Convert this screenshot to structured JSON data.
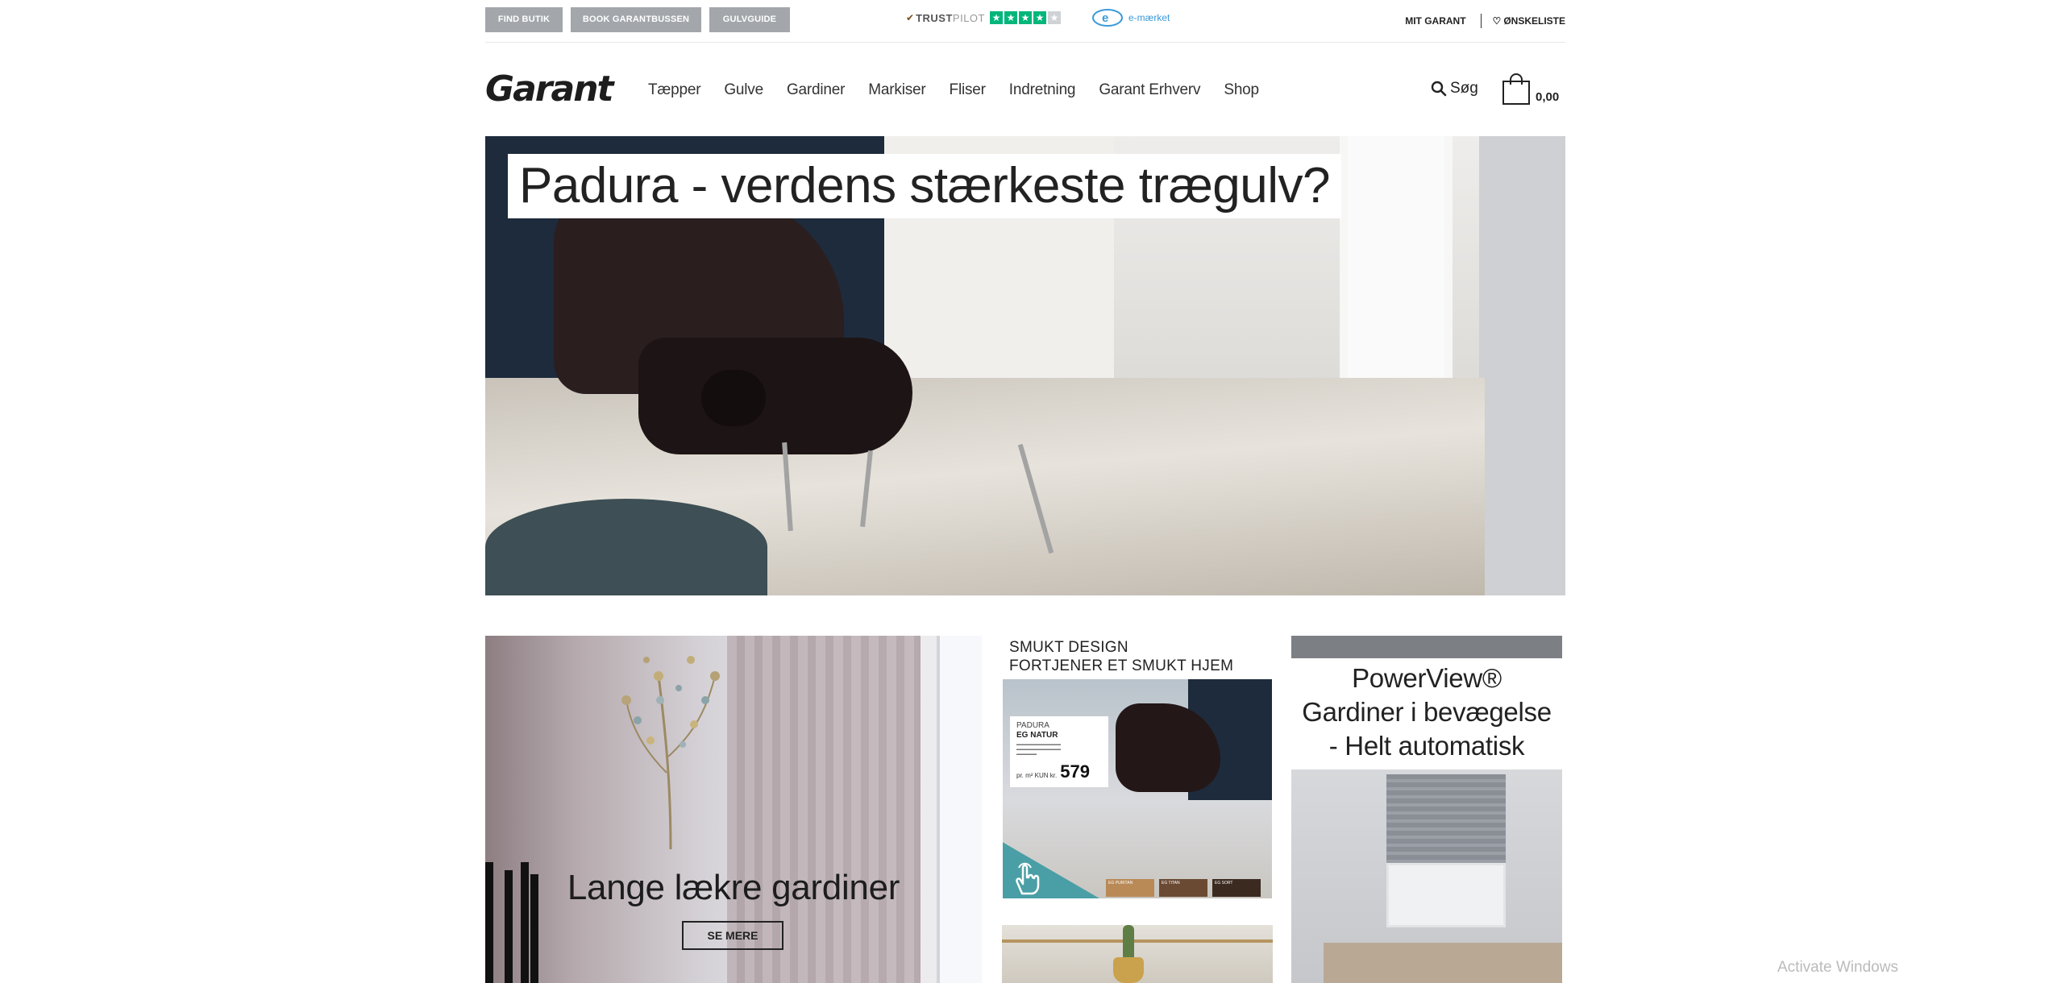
{
  "topbar": {
    "buttons": [
      "FIND BUTIK",
      "BOOK GARANTBUSSEN",
      "GULVGUIDE"
    ],
    "trustpilot_strong": "TRUST",
    "trustpilot_light": "PILOT",
    "trustpilot_stars": 4,
    "emark_label": "e-mærket",
    "account_link": "MIT GARANT",
    "wishlist_link": "ØNSKELISTE"
  },
  "nav": {
    "logo": "Garant",
    "items": [
      "Tæpper",
      "Gulve",
      "Gardiner",
      "Markiser",
      "Fliser",
      "Indretning",
      "Garant Erhverv",
      "Shop"
    ],
    "search_label": "Søg",
    "cart_amount": "0,00"
  },
  "hero": {
    "title": "Padura - verdens stærkeste trægulv?"
  },
  "promo_curtains": {
    "title": "Lange lækre gardiner",
    "button": "SE MERE"
  },
  "promo_padura": {
    "heading_line1": "SMUKT DESIGN",
    "heading_line2": "FORTJENER ET SMUKT HJEM",
    "product_line1": "PADURA",
    "product_line2": "EG NATUR",
    "price_prefix": "pr. m² KUN kr.",
    "price": "579",
    "swatches": [
      {
        "label": "EG PURITAN",
        "color": "#b98a56"
      },
      {
        "label": "EG TITAN",
        "color": "#6b4a33"
      },
      {
        "label": "EG SORT",
        "color": "#3b2a20"
      }
    ]
  },
  "promo_powerview": {
    "line1": "PowerView®",
    "line2": "Gardiner i bevægelse",
    "line3": "- Helt automatisk"
  },
  "os_watermark": "Activate Windows"
}
